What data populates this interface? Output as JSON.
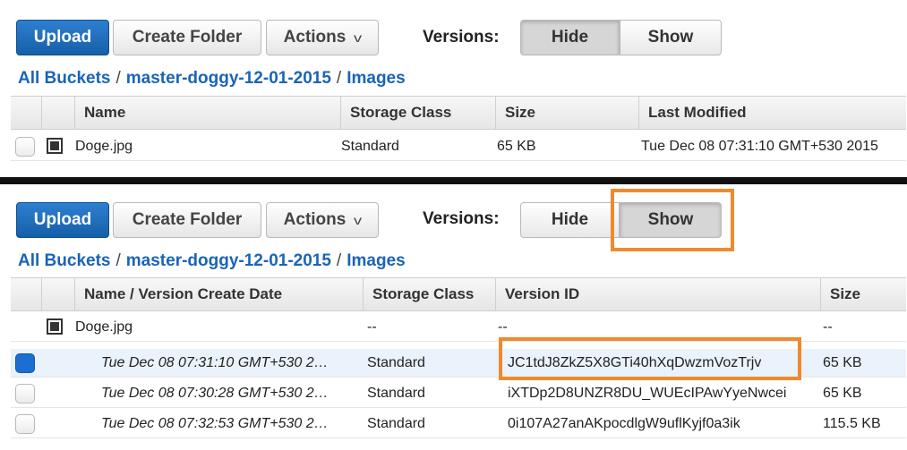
{
  "toolbar": {
    "upload_label": "Upload",
    "create_folder_label": "Create Folder",
    "actions_label": "Actions",
    "versions_label": "Versions:",
    "hide_label": "Hide",
    "show_label": "Show"
  },
  "breadcrumb": {
    "root": "All Buckets",
    "separator": "/",
    "bucket": "master-doggy-12-01-2015",
    "folder": "Images"
  },
  "view1": {
    "versions_mode": "Hide",
    "columns": [
      "Name",
      "Storage Class",
      "Size",
      "Last Modified"
    ],
    "rows": [
      {
        "name": "Doge.jpg",
        "storage_class": "Standard",
        "size": "65 KB",
        "last_modified": "Tue Dec 08 07:31:10 GMT+530 2015"
      }
    ]
  },
  "view2": {
    "versions_mode": "Show",
    "columns": [
      "Name / Version Create Date",
      "Storage Class",
      "Version ID",
      "Size"
    ],
    "object_row": {
      "name": "Doge.jpg",
      "storage_class": "--",
      "version_id": "--",
      "size": "--"
    },
    "versions": [
      {
        "date": "Tue Dec 08 07:31:10 GMT+530 2…",
        "storage_class": "Standard",
        "version_id": "JC1tdJ8ZkZ5X8GTi40hXqDwzmVozTrjv",
        "size": "65 KB",
        "checked": true
      },
      {
        "date": "Tue Dec 08 07:30:28 GMT+530 2…",
        "storage_class": "Standard",
        "version_id": "iXTDp2D8UNZR8DU_WUEcIPAwYyeNwcei",
        "size": "65 KB",
        "checked": false
      },
      {
        "date": "Tue Dec 08 07:32:53 GMT+530 2…",
        "storage_class": "Standard",
        "version_id": "0i107A27anAKpocdlgW9uflKyjf0a3ik",
        "size": "115.5 KB",
        "checked": false
      }
    ]
  },
  "colors": {
    "primary": "#155fa8",
    "link": "#1a64b8",
    "highlight": "#f08a2c",
    "checked": "#1a6fd1"
  },
  "icons": [
    "chevron-down-icon",
    "file-icon",
    "checkbox"
  ]
}
